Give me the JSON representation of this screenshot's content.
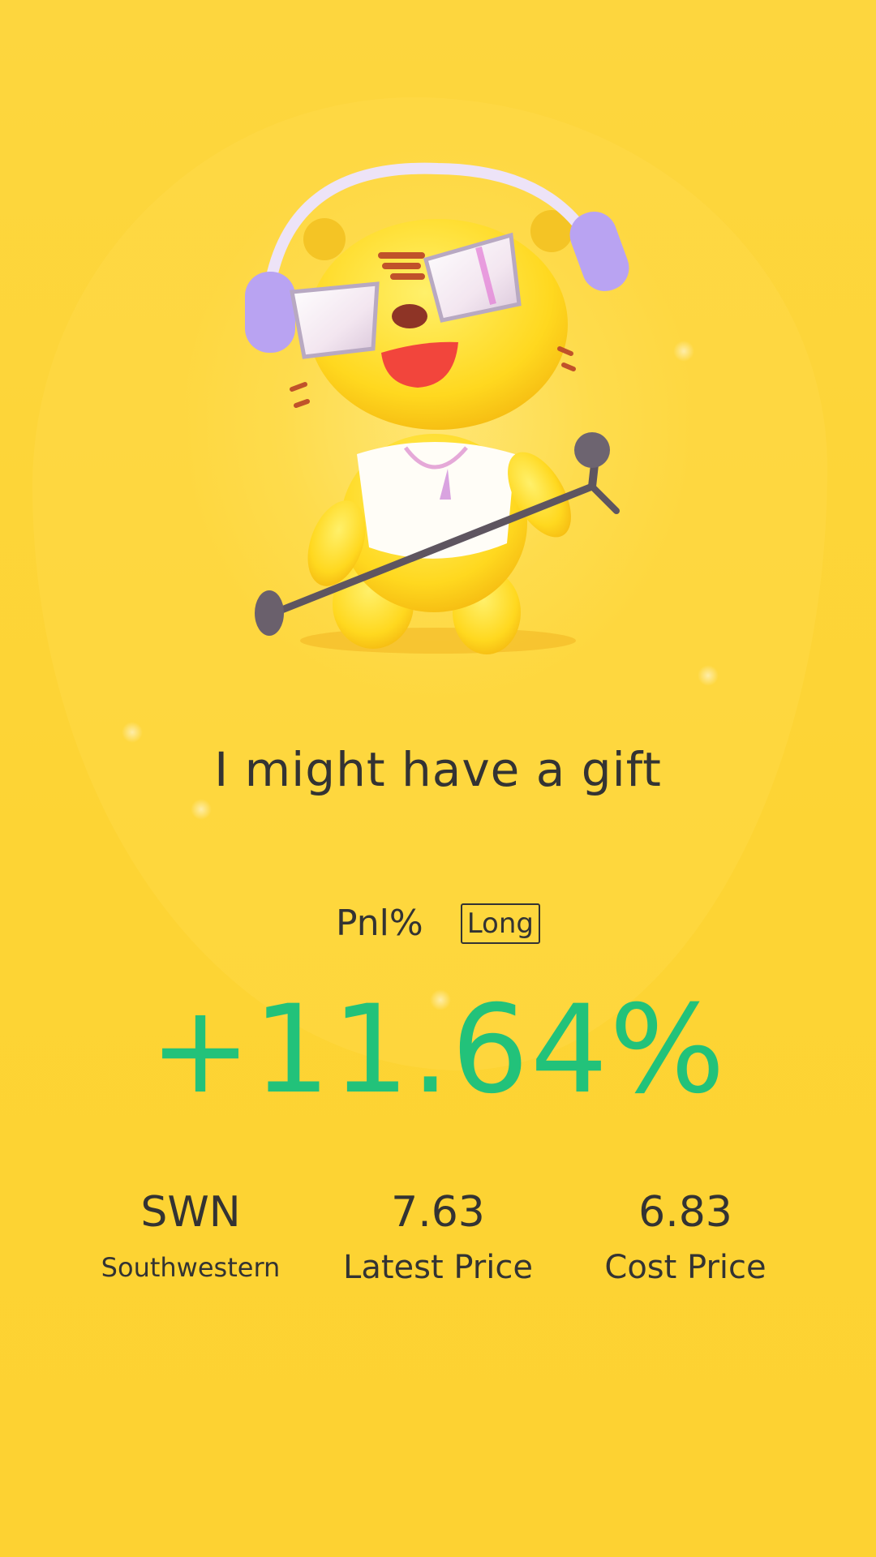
{
  "headline": "I might have a gift",
  "pnl": {
    "label": "Pnl%",
    "direction": "Long",
    "value": "+11.64%"
  },
  "stats": {
    "symbol": {
      "value": "SWN",
      "label": "Southwestern"
    },
    "latest": {
      "value": "7.63",
      "label": "Latest Price"
    },
    "cost": {
      "value": "6.83",
      "label": "Cost Price"
    }
  },
  "colors": {
    "background": "#FDD435",
    "text": "#333333",
    "profit": "#22C27A"
  },
  "mascot": {
    "icon": "tiger-mascot-with-headphones-and-microphone"
  }
}
